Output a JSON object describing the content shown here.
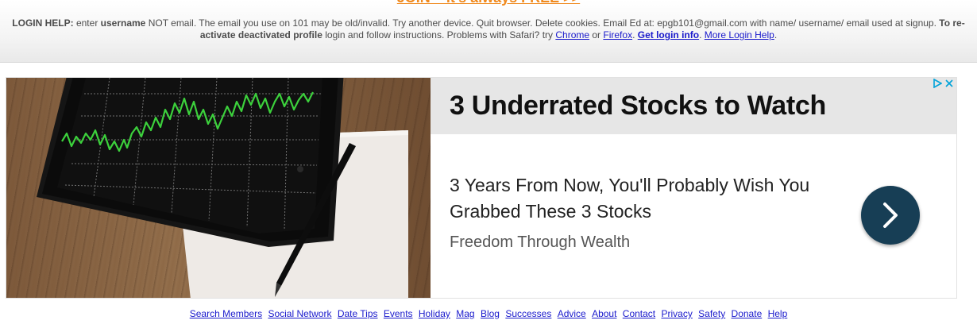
{
  "header": {
    "join_text": "JOIN – it's always FREE >>",
    "login_help": {
      "label": "LOGIN HELP:",
      "t1": " enter ",
      "username": "username",
      "t2": " NOT email. The email you use on 101 may be old/invalid. Try another device. Quit browser. Delete cookies. Email Ed at: epgb101@gmail.com with name/ username/ email used at signup. ",
      "reactivate": "To re-activate deactivated profile",
      "t3": " login and follow instructions. Problems with Safari? try ",
      "chrome": "Chrome",
      "or": " or ",
      "firefox": "Firefox",
      "dot": ". ",
      "get_login_info": "Get login info",
      "dot2": ". ",
      "more_help": "More Login Help",
      "end": "."
    }
  },
  "ad": {
    "headline": "3 Underrated Stocks to Watch",
    "body": "3 Years From Now, You'll Probably Wish You Grabbed These 3 Stocks",
    "source": "Freedom Through Wealth",
    "cta_icon": "chevron-right-icon",
    "choices_icons": [
      "adchoices-icon",
      "close-icon"
    ],
    "accent_color": "#173e55",
    "headline_band_color": "#e6e6e6"
  },
  "footer": {
    "links": [
      "Search Members",
      "Social Network",
      "Date Tips",
      "Events",
      "Holiday",
      "Mag",
      "Blog",
      "Successes",
      "Advice",
      "About",
      "Contact",
      "Privacy",
      "Safety",
      "Donate",
      "Help"
    ]
  }
}
